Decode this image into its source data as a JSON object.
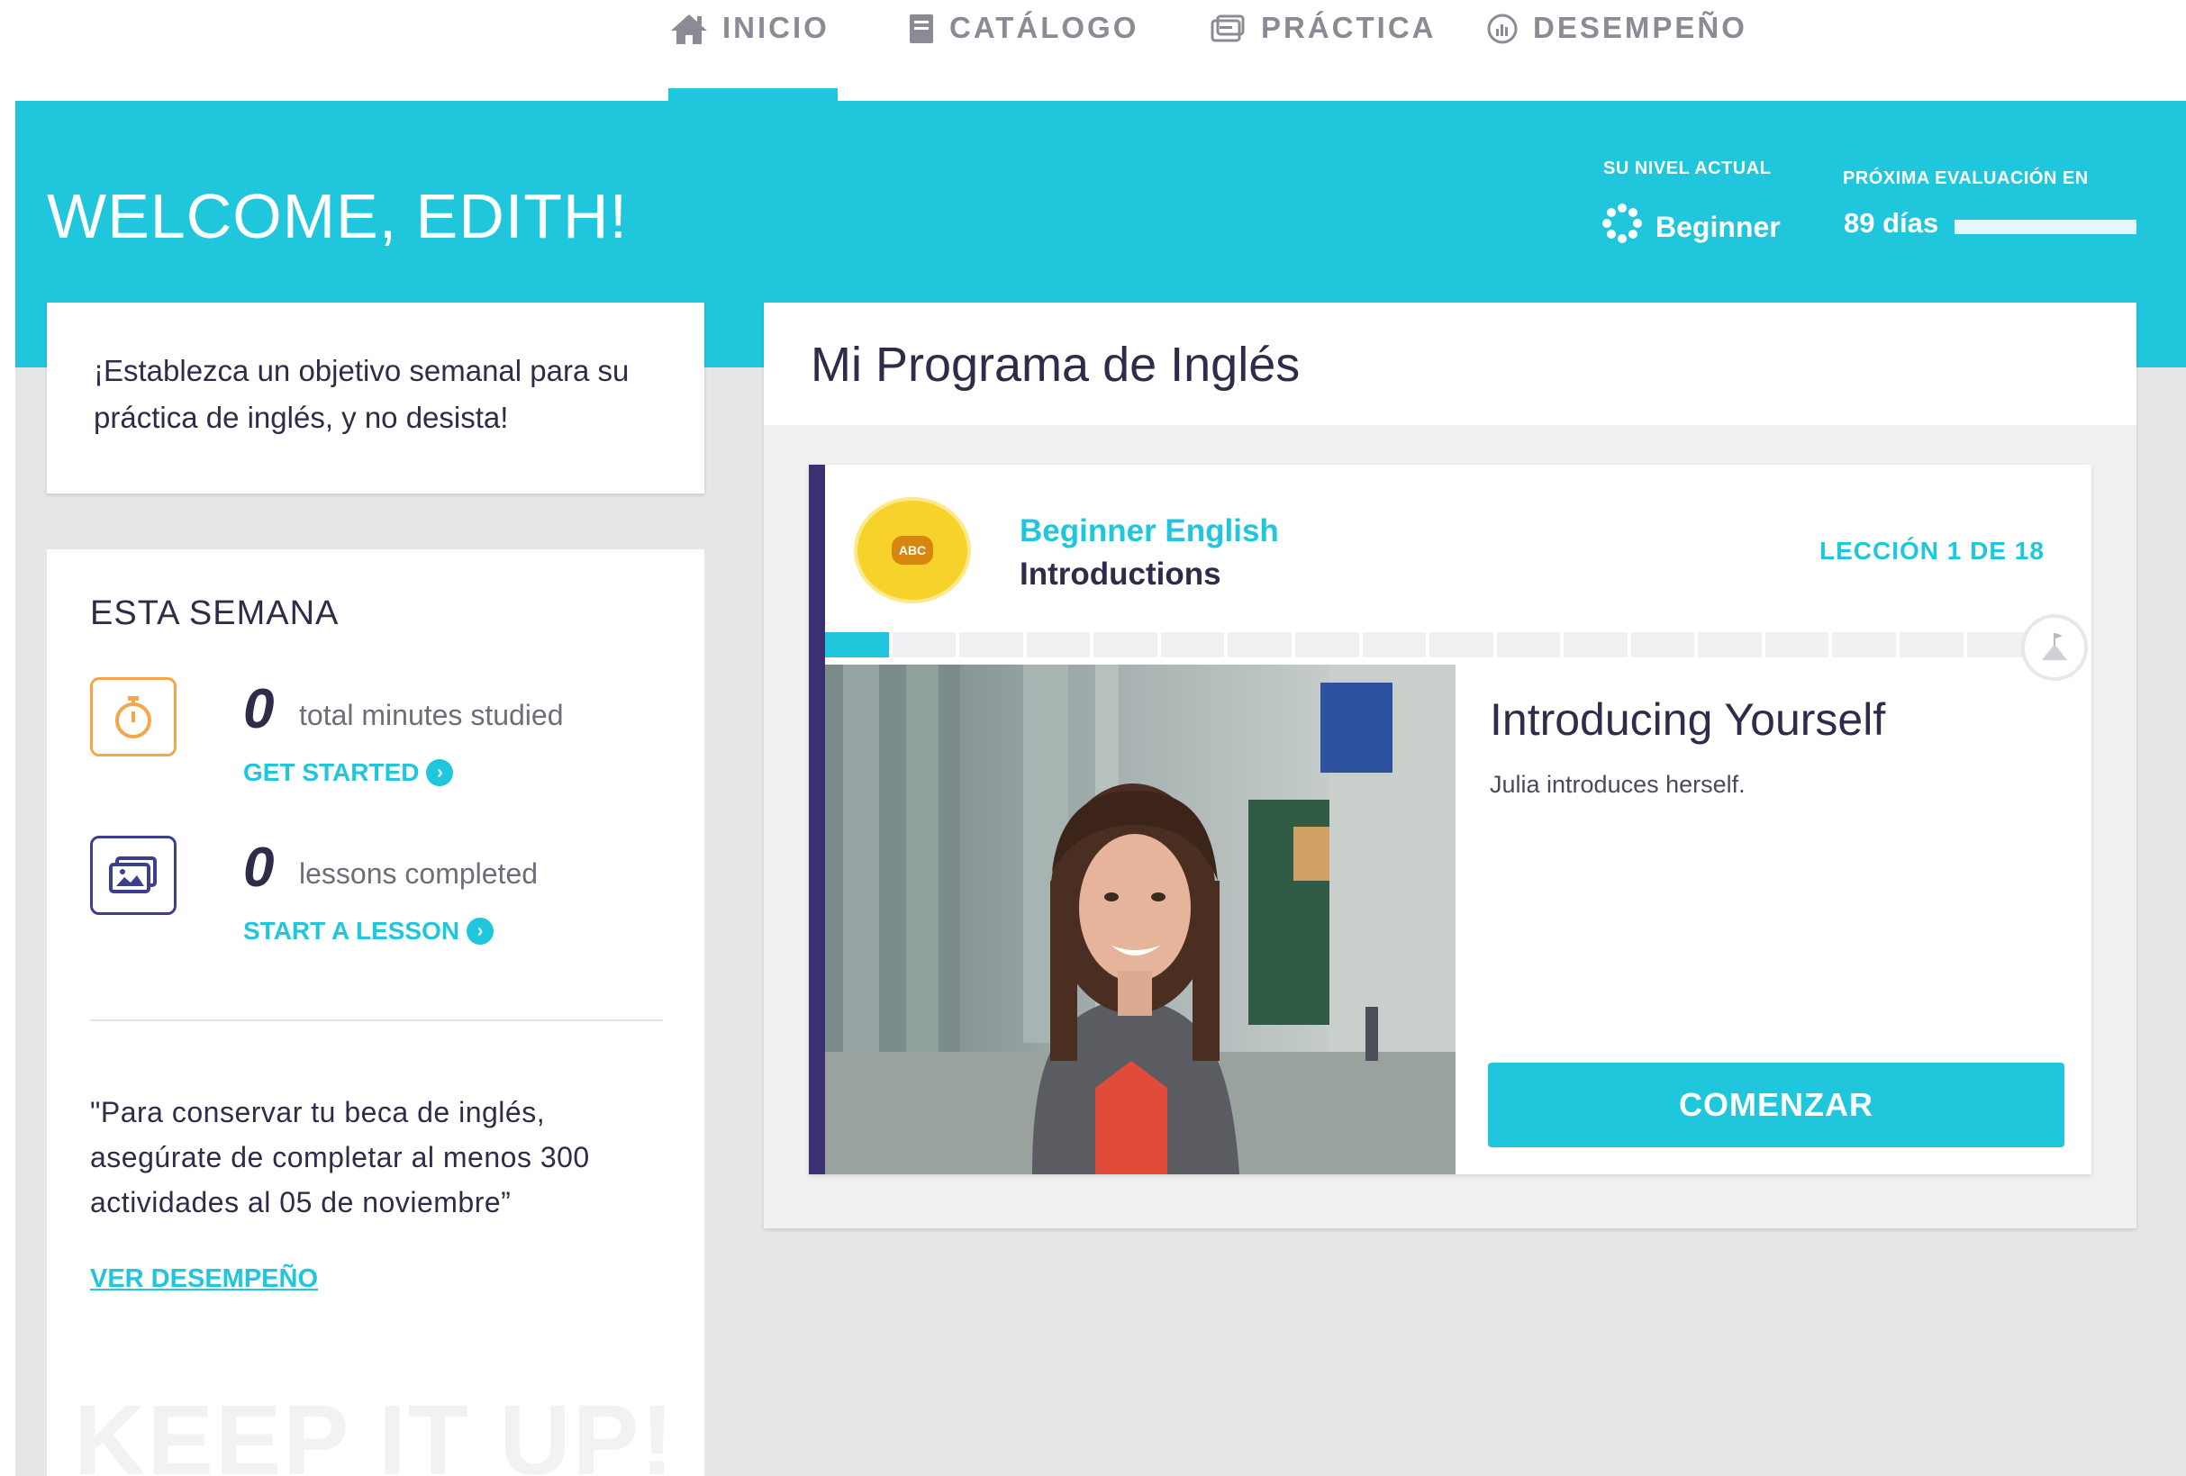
{
  "nav": {
    "items": [
      {
        "label": "INICIO",
        "icon": "home-icon"
      },
      {
        "label": "CATÁLOGO",
        "icon": "book-icon"
      },
      {
        "label": "PRÁCTICA",
        "icon": "practice-icon"
      },
      {
        "label": "DESEMPEÑO",
        "icon": "performance-icon"
      }
    ],
    "active": "INICIO"
  },
  "banner": {
    "welcome": "WELCOME, EDITH!",
    "level_label": "SU NIVEL ACTUAL",
    "level_value": "Beginner",
    "eval_label": "PRÓXIMA EVALUACIÓN EN",
    "eval_value": "89 días"
  },
  "goal": {
    "text": "¡Establezca un objetivo semanal para su práctica de inglés, y no desista!"
  },
  "week": {
    "title": "ESTA SEMANA",
    "minutes": {
      "value": "0",
      "label": "total minutes studied",
      "link": "GET STARTED"
    },
    "lessons": {
      "value": "0",
      "label": "lessons completed",
      "link": "START A LESSON"
    },
    "quote": "\"Para conservar tu beca de inglés, asegúrate de completar al menos 300 actividades al 05 de noviembre”",
    "perf_link": "VER DESEMPEÑO",
    "watermark": "KEEP IT UP!"
  },
  "program": {
    "title": "Mi Programa de Inglés",
    "course": "Beginner English",
    "unit": "Introductions",
    "badge_text": "ABC",
    "lesson_count": "LECCIÓN 1 DE 18",
    "progress": {
      "completed": 1,
      "total": 18
    },
    "lesson_title": "Introducing Yourself",
    "lesson_desc": "Julia introduces herself.",
    "start_button": "COMENZAR"
  },
  "colors": {
    "accent": "#1fc6dc",
    "navy": "#3a3072",
    "orange": "#f6a54a",
    "text": "#2d2d4a"
  }
}
